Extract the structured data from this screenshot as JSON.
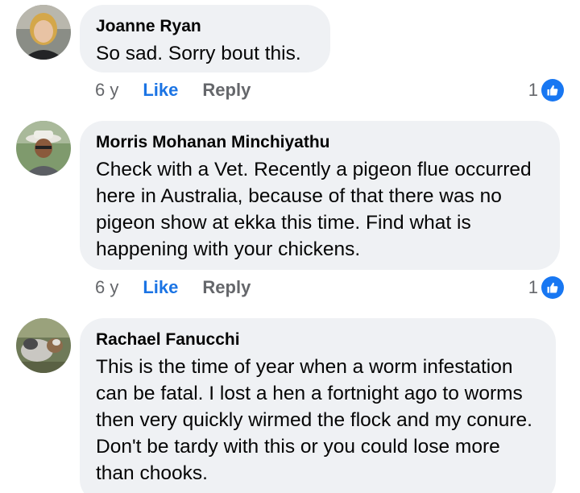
{
  "comments": [
    {
      "author": "Joanne Ryan",
      "text": "So sad. Sorry bout this.",
      "time": "6 y",
      "like_label": "Like",
      "reply_label": "Reply",
      "reaction_count": "1"
    },
    {
      "author": "Morris Mohanan Minchiyathu",
      "text": "Check with a Vet. Recently a pigeon flue occurred here in Australia, because of that there was no pigeon show at ekka this time. Find what is happening with your chickens.",
      "time": "6 y",
      "like_label": "Like",
      "reply_label": "Reply",
      "reaction_count": "1"
    },
    {
      "author": "Rachael Fanucchi",
      "text": "This is the time of year when a worm infestation can be fatal. I lost a hen a fortnight ago to worms then very quickly wirmed the flock and my conure. Don't be tardy with this or you could lose more than chooks."
    }
  ],
  "colors": {
    "bubble": "#eff1f4",
    "like_link": "#1b74e4",
    "meta_text": "#65676b",
    "reaction_badge": "#1877f2"
  },
  "icons": {
    "reaction": "thumbs-up-icon"
  }
}
